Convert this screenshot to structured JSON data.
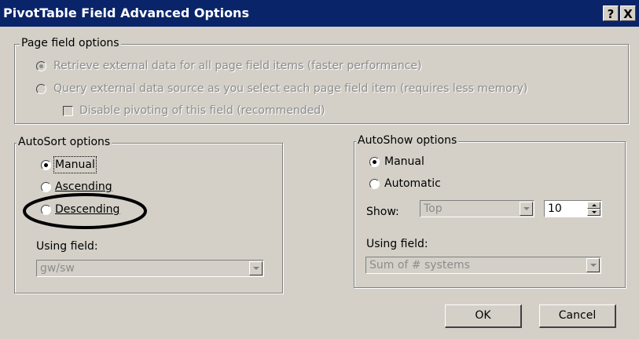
{
  "window": {
    "title": "PivotTable Field Advanced Options",
    "help_glyph": "?",
    "close_glyph": "X"
  },
  "page_field": {
    "legend": "Page field options",
    "retrieve_label": "Retrieve external data for all page field items (faster performance)",
    "query_label": "Query external data source as you select each page field item (requires less memory)",
    "disable_label": "Disable pivoting of this field (recommended)"
  },
  "autosort": {
    "legend": "AutoSort options",
    "manual_label": "Manual",
    "ascending_label": "Ascending",
    "descending_label": "Descending",
    "selected": "Manual",
    "using_field_label": "Using field:",
    "using_field_value": "gw/sw"
  },
  "autoshow": {
    "legend": "AutoShow options",
    "manual_label": "Manual",
    "automatic_label": "Automatic",
    "selected": "Manual",
    "show_label": "Show:",
    "show_value": "Top",
    "count_value": "10",
    "using_field_label": "Using field:",
    "using_field_value": "Sum of # systems"
  },
  "buttons": {
    "ok_label": "OK",
    "cancel_label": "Cancel"
  },
  "annotation": {
    "highlighted_option": "Descending"
  }
}
